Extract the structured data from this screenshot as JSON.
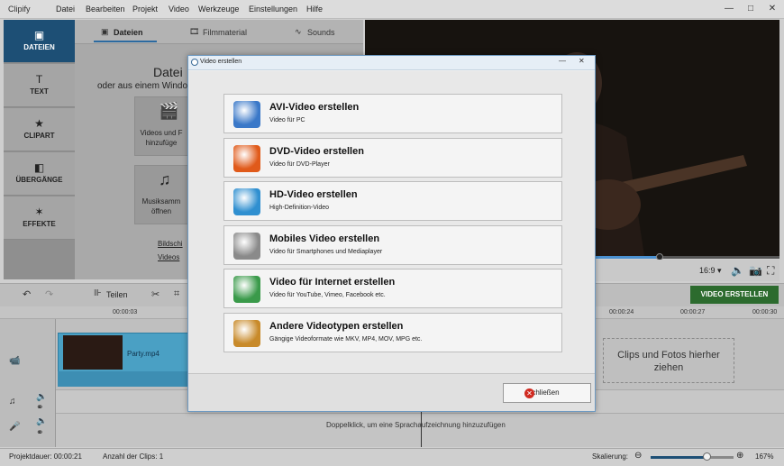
{
  "app": {
    "title": "Clipify"
  },
  "menu": [
    "Datei",
    "Bearbeiten",
    "Projekt",
    "Video",
    "Werkzeuge",
    "Einstellungen",
    "Hilfe"
  ],
  "window_controls": {
    "minimize": "—",
    "maximize": "□",
    "close": "✕"
  },
  "sidebar": {
    "items": [
      {
        "label": "DATEIEN",
        "icon": "image-icon",
        "glyph": "▣",
        "active": true
      },
      {
        "label": "TEXT",
        "icon": "text-icon",
        "glyph": "T"
      },
      {
        "label": "CLIPART",
        "icon": "star-icon",
        "glyph": "★"
      },
      {
        "label": "ÜBERGÄNGE",
        "icon": "transition-icon",
        "glyph": "◧"
      },
      {
        "label": "EFFEKTE",
        "icon": "magic-wand-icon",
        "glyph": "✶"
      }
    ]
  },
  "tabs": [
    {
      "label": "Dateien",
      "icon": "▣",
      "active": true
    },
    {
      "label": "Filmmaterial",
      "icon": "🎞"
    },
    {
      "label": "Sounds",
      "icon": "∿"
    }
  ],
  "panel": {
    "heading": "Datei",
    "subheading": "oder aus einem Windo",
    "tiles": [
      {
        "label": "Videos und F hinzufüge",
        "glyph": "🎬"
      },
      {
        "label": "Musiksamm öffnen",
        "glyph": "♫"
      }
    ],
    "links": [
      "Bildschi",
      "Videos"
    ]
  },
  "preview": {
    "aspect": "16:9 ▾",
    "seek_progress": 0.71
  },
  "toolbar": {
    "split_label": "Teilen",
    "create_video": "VIDEO ERSTELLEN"
  },
  "ruler": [
    "00:00:03",
    "00:00:24",
    "00:00:27",
    "00:00:30"
  ],
  "timeline": {
    "clip_name": "Party.mp4",
    "dropzone": "Clips und Fotos hierher ziehen",
    "voice_hint": "Doppelklick, um eine Sprachaufzeichnung hinzuzufügen"
  },
  "status": {
    "duration": "Projektdauer:   00:00:21",
    "clips": "Anzahl der Clips: 1",
    "zoom_label": "Skalierung:",
    "zoom_value": "167%",
    "zoom_level": 0.67
  },
  "dialog": {
    "title": "Video erstellen",
    "options": [
      {
        "title": "AVI-Video erstellen",
        "subtitle": "Video für PC",
        "icon": "avi-icon",
        "color": "#3a78c8"
      },
      {
        "title": "DVD-Video erstellen",
        "subtitle": "Video für DVD-Player",
        "icon": "dvd-icon",
        "color": "#e05a1a"
      },
      {
        "title": "HD-Video erstellen",
        "subtitle": "High-Definition-Video",
        "icon": "hd-monitor-icon",
        "color": "#2f8fd0"
      },
      {
        "title": "Mobiles Video erstellen",
        "subtitle": "Video für Smartphones und Mediaplayer",
        "icon": "smartphone-icon",
        "color": "#8a8a8a"
      },
      {
        "title": "Video für Internet erstellen",
        "subtitle": "Video für YouTube, Vimeo, Facebook etc.",
        "icon": "globe-icon",
        "color": "#3a9a4a"
      },
      {
        "title": "Andere Videotypen erstellen",
        "subtitle": "Gängige Videoformate wie MKV, MP4, MOV, MPG etc.",
        "icon": "film-reel-icon",
        "color": "#c88a2a"
      }
    ],
    "close_label": "Schließen"
  }
}
